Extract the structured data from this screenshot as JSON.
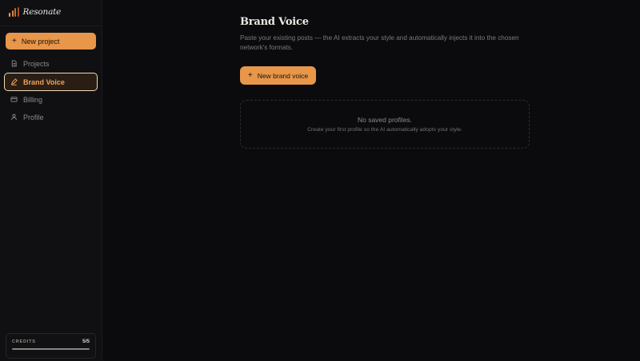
{
  "app": {
    "name": "Resonate",
    "logo_colors": [
      "#f2a55c",
      "#e0883d",
      "#c96b2b",
      "#a94f22"
    ]
  },
  "colors": {
    "accent": "#e8964a",
    "active_text": "#f0a35d",
    "background": "#0b0b0e",
    "sidebar": "#101013"
  },
  "sidebar": {
    "new_project_label": "New project",
    "items": [
      {
        "label": "Projects",
        "icon": "document-icon",
        "active": false
      },
      {
        "label": "Brand Voice",
        "icon": "pen-icon",
        "active": true
      },
      {
        "label": "Billing",
        "icon": "credit-card-icon",
        "active": false
      },
      {
        "label": "Profile",
        "icon": "user-icon",
        "active": false
      }
    ],
    "credits": {
      "label": "CREDITS",
      "value": "5/5",
      "fraction": 1.0
    }
  },
  "main": {
    "title": "Brand Voice",
    "description": "Paste your existing posts — the AI extracts your style and automatically injects it into the chosen network's formats.",
    "new_voice_label": "New brand voice",
    "empty": {
      "title": "No saved profiles.",
      "subtitle": "Create your first profile so the AI automatically adopts your style."
    }
  }
}
